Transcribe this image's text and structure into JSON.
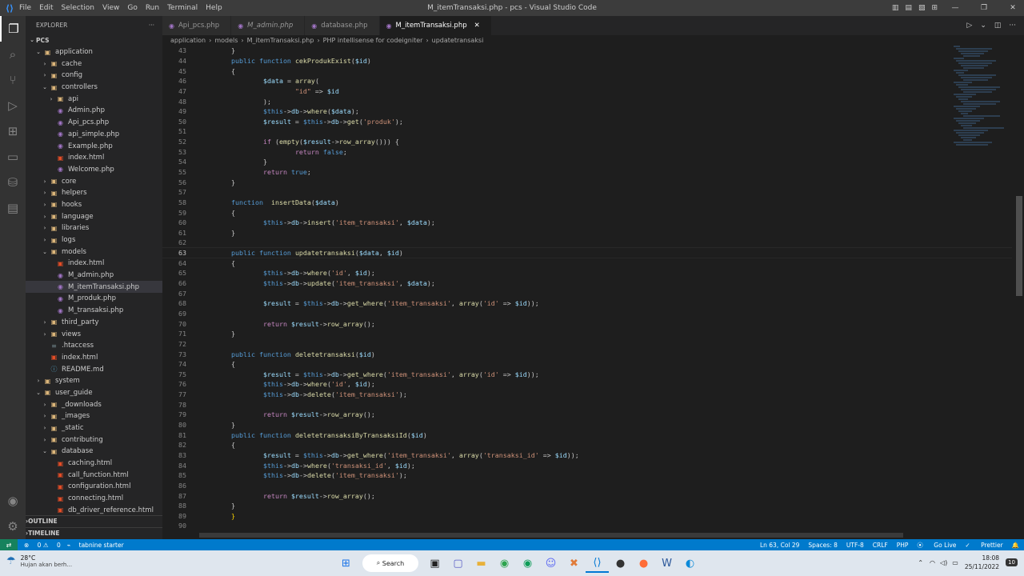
{
  "window": {
    "title": "M_itemTransaksi.php - pcs - Visual Studio Code",
    "menu": [
      "File",
      "Edit",
      "Selection",
      "View",
      "Go",
      "Run",
      "Terminal",
      "Help"
    ]
  },
  "sidebar": {
    "header": "EXPLORER",
    "root": "PCS",
    "tree": [
      {
        "label": "application",
        "depth": 1,
        "kind": "folder",
        "open": true
      },
      {
        "label": "cache",
        "depth": 2,
        "kind": "folder"
      },
      {
        "label": "config",
        "depth": 2,
        "kind": "folder"
      },
      {
        "label": "controllers",
        "depth": 2,
        "kind": "folder",
        "open": true
      },
      {
        "label": "api",
        "depth": 3,
        "kind": "folder"
      },
      {
        "label": "Admin.php",
        "depth": 3,
        "kind": "php"
      },
      {
        "label": "Api_pcs.php",
        "depth": 3,
        "kind": "php"
      },
      {
        "label": "api_simple.php",
        "depth": 3,
        "kind": "php"
      },
      {
        "label": "Example.php",
        "depth": 3,
        "kind": "php"
      },
      {
        "label": "index.html",
        "depth": 3,
        "kind": "html"
      },
      {
        "label": "Welcome.php",
        "depth": 3,
        "kind": "php"
      },
      {
        "label": "core",
        "depth": 2,
        "kind": "folder"
      },
      {
        "label": "helpers",
        "depth": 2,
        "kind": "folder"
      },
      {
        "label": "hooks",
        "depth": 2,
        "kind": "folder"
      },
      {
        "label": "language",
        "depth": 2,
        "kind": "folder"
      },
      {
        "label": "libraries",
        "depth": 2,
        "kind": "folder"
      },
      {
        "label": "logs",
        "depth": 2,
        "kind": "folder"
      },
      {
        "label": "models",
        "depth": 2,
        "kind": "folder",
        "open": true
      },
      {
        "label": "index.html",
        "depth": 3,
        "kind": "html"
      },
      {
        "label": "M_admin.php",
        "depth": 3,
        "kind": "php"
      },
      {
        "label": "M_itemTransaksi.php",
        "depth": 3,
        "kind": "php",
        "selected": true
      },
      {
        "label": "M_produk.php",
        "depth": 3,
        "kind": "php"
      },
      {
        "label": "M_transaksi.php",
        "depth": 3,
        "kind": "php"
      },
      {
        "label": "third_party",
        "depth": 2,
        "kind": "folder"
      },
      {
        "label": "views",
        "depth": 2,
        "kind": "folder"
      },
      {
        "label": ".htaccess",
        "depth": 2,
        "kind": "gen"
      },
      {
        "label": "index.html",
        "depth": 2,
        "kind": "html"
      },
      {
        "label": "README.md",
        "depth": 2,
        "kind": "md"
      },
      {
        "label": "system",
        "depth": 1,
        "kind": "folder"
      },
      {
        "label": "user_guide",
        "depth": 1,
        "kind": "folder",
        "open": true
      },
      {
        "label": "_downloads",
        "depth": 2,
        "kind": "folder"
      },
      {
        "label": "_images",
        "depth": 2,
        "kind": "folder"
      },
      {
        "label": "_static",
        "depth": 2,
        "kind": "folder"
      },
      {
        "label": "contributing",
        "depth": 2,
        "kind": "folder"
      },
      {
        "label": "database",
        "depth": 2,
        "kind": "folder",
        "open": true
      },
      {
        "label": "caching.html",
        "depth": 3,
        "kind": "html"
      },
      {
        "label": "call_function.html",
        "depth": 3,
        "kind": "html"
      },
      {
        "label": "configuration.html",
        "depth": 3,
        "kind": "html"
      },
      {
        "label": "connecting.html",
        "depth": 3,
        "kind": "html"
      },
      {
        "label": "db_driver_reference.html",
        "depth": 3,
        "kind": "html"
      }
    ],
    "outline": "OUTLINE",
    "timeline": "TIMELINE"
  },
  "tabs": [
    {
      "label": "Api_pcs.php"
    },
    {
      "label": "M_admin.php",
      "italic": true
    },
    {
      "label": "database.php"
    },
    {
      "label": "M_itemTransaksi.php",
      "active": true
    }
  ],
  "breadcrumb": [
    "application",
    "models",
    "M_itemTransaksi.php",
    "PHP intellisense for codeigniter",
    "updatetransaksi"
  ],
  "editor": {
    "first_line": 43,
    "current_line": 63,
    "lines": [
      [
        [
          "p",
          "}"
        ]
      ],
      [
        [
          "k",
          "public "
        ],
        [
          "k",
          "function "
        ],
        [
          "f",
          "cekProdukExist"
        ],
        [
          "p",
          "("
        ],
        [
          "v",
          "$id"
        ],
        [
          "p",
          ")"
        ]
      ],
      [
        [
          "p",
          "{"
        ]
      ],
      [
        [
          "p",
          "        "
        ],
        [
          "v",
          "$data"
        ],
        [
          "p",
          " = "
        ],
        [
          "f",
          "array"
        ],
        [
          "p",
          "("
        ]
      ],
      [
        [
          "p",
          "                "
        ],
        [
          "s",
          "\"id\""
        ],
        [
          "p",
          " => "
        ],
        [
          "v",
          "$id"
        ]
      ],
      [
        [
          "p",
          "        );"
        ]
      ],
      [
        [
          "p",
          "        "
        ],
        [
          "k",
          "$this"
        ],
        [
          "p",
          "->"
        ],
        [
          "v",
          "db"
        ],
        [
          "p",
          "->"
        ],
        [
          "f",
          "where"
        ],
        [
          "p",
          "("
        ],
        [
          "v",
          "$data"
        ],
        [
          "p",
          ");"
        ]
      ],
      [
        [
          "p",
          "        "
        ],
        [
          "v",
          "$result"
        ],
        [
          "p",
          " = "
        ],
        [
          "k",
          "$this"
        ],
        [
          "p",
          "->"
        ],
        [
          "v",
          "db"
        ],
        [
          "p",
          "->"
        ],
        [
          "f",
          "get"
        ],
        [
          "p",
          "("
        ],
        [
          "s",
          "'produk'"
        ],
        [
          "p",
          ");"
        ]
      ],
      [
        [
          "p",
          ""
        ]
      ],
      [
        [
          "p",
          "        "
        ],
        [
          "c",
          "if "
        ],
        [
          "p",
          "("
        ],
        [
          "f",
          "empty"
        ],
        [
          "p",
          "("
        ],
        [
          "v",
          "$result"
        ],
        [
          "p",
          "->"
        ],
        [
          "f",
          "row_array"
        ],
        [
          "p",
          "())) {"
        ]
      ],
      [
        [
          "p",
          "                "
        ],
        [
          "c",
          "return "
        ],
        [
          "k",
          "false"
        ],
        [
          "p",
          ";"
        ]
      ],
      [
        [
          "p",
          "        }"
        ]
      ],
      [
        [
          "p",
          "        "
        ],
        [
          "c",
          "return "
        ],
        [
          "k",
          "true"
        ],
        [
          "p",
          ";"
        ]
      ],
      [
        [
          "p",
          "}"
        ]
      ],
      [
        [
          "p",
          ""
        ]
      ],
      [
        [
          "k",
          "function "
        ],
        [
          "p",
          " "
        ],
        [
          "f",
          "insertData"
        ],
        [
          "p",
          "("
        ],
        [
          "v",
          "$data"
        ],
        [
          "p",
          ")"
        ]
      ],
      [
        [
          "p",
          "{"
        ]
      ],
      [
        [
          "p",
          "        "
        ],
        [
          "k",
          "$this"
        ],
        [
          "p",
          "->"
        ],
        [
          "v",
          "db"
        ],
        [
          "p",
          "->"
        ],
        [
          "f",
          "insert"
        ],
        [
          "p",
          "("
        ],
        [
          "s",
          "'item_transaksi'"
        ],
        [
          "p",
          ", "
        ],
        [
          "v",
          "$data"
        ],
        [
          "p",
          ");"
        ]
      ],
      [
        [
          "p",
          "}"
        ]
      ],
      [
        [
          "p",
          ""
        ]
      ],
      [
        [
          "k",
          "public "
        ],
        [
          "k",
          "function "
        ],
        [
          "f",
          "updatetransaksi"
        ],
        [
          "p",
          "("
        ],
        [
          "v",
          "$data"
        ],
        [
          "p",
          ", "
        ],
        [
          "v",
          "$id"
        ],
        [
          "p",
          ")"
        ]
      ],
      [
        [
          "p",
          "{"
        ]
      ],
      [
        [
          "p",
          "        "
        ],
        [
          "k",
          "$this"
        ],
        [
          "p",
          "->"
        ],
        [
          "v",
          "db"
        ],
        [
          "p",
          "->"
        ],
        [
          "f",
          "where"
        ],
        [
          "p",
          "("
        ],
        [
          "s",
          "'id'"
        ],
        [
          "p",
          ", "
        ],
        [
          "v",
          "$id"
        ],
        [
          "p",
          ");"
        ]
      ],
      [
        [
          "p",
          "        "
        ],
        [
          "k",
          "$this"
        ],
        [
          "p",
          "->"
        ],
        [
          "v",
          "db"
        ],
        [
          "p",
          "->"
        ],
        [
          "f",
          "update"
        ],
        [
          "p",
          "("
        ],
        [
          "s",
          "'item_transaksi'"
        ],
        [
          "p",
          ", "
        ],
        [
          "v",
          "$data"
        ],
        [
          "p",
          ");"
        ]
      ],
      [
        [
          "p",
          ""
        ]
      ],
      [
        [
          "p",
          "        "
        ],
        [
          "v",
          "$result"
        ],
        [
          "p",
          " = "
        ],
        [
          "k",
          "$this"
        ],
        [
          "p",
          "->"
        ],
        [
          "v",
          "db"
        ],
        [
          "p",
          "->"
        ],
        [
          "f",
          "get_where"
        ],
        [
          "p",
          "("
        ],
        [
          "s",
          "'item_transaksi'"
        ],
        [
          "p",
          ", "
        ],
        [
          "f",
          "array"
        ],
        [
          "p",
          "("
        ],
        [
          "s",
          "'id'"
        ],
        [
          "p",
          " => "
        ],
        [
          "v",
          "$id"
        ],
        [
          "p",
          "));"
        ]
      ],
      [
        [
          "p",
          ""
        ]
      ],
      [
        [
          "p",
          "        "
        ],
        [
          "c",
          "return "
        ],
        [
          "v",
          "$result"
        ],
        [
          "p",
          "->"
        ],
        [
          "f",
          "row_array"
        ],
        [
          "p",
          "();"
        ]
      ],
      [
        [
          "p",
          "}"
        ]
      ],
      [
        [
          "p",
          ""
        ]
      ],
      [
        [
          "k",
          "public "
        ],
        [
          "k",
          "function "
        ],
        [
          "f",
          "deletetransaksi"
        ],
        [
          "p",
          "("
        ],
        [
          "v",
          "$id"
        ],
        [
          "p",
          ")"
        ]
      ],
      [
        [
          "p",
          "{"
        ]
      ],
      [
        [
          "p",
          "        "
        ],
        [
          "v",
          "$result"
        ],
        [
          "p",
          " = "
        ],
        [
          "k",
          "$this"
        ],
        [
          "p",
          "->"
        ],
        [
          "v",
          "db"
        ],
        [
          "p",
          "->"
        ],
        [
          "f",
          "get_where"
        ],
        [
          "p",
          "("
        ],
        [
          "s",
          "'item_transaksi'"
        ],
        [
          "p",
          ", "
        ],
        [
          "f",
          "array"
        ],
        [
          "p",
          "("
        ],
        [
          "s",
          "'id'"
        ],
        [
          "p",
          " => "
        ],
        [
          "v",
          "$id"
        ],
        [
          "p",
          "));"
        ]
      ],
      [
        [
          "p",
          "        "
        ],
        [
          "k",
          "$this"
        ],
        [
          "p",
          "->"
        ],
        [
          "v",
          "db"
        ],
        [
          "p",
          "->"
        ],
        [
          "f",
          "where"
        ],
        [
          "p",
          "("
        ],
        [
          "s",
          "'id'"
        ],
        [
          "p",
          ", "
        ],
        [
          "v",
          "$id"
        ],
        [
          "p",
          ");"
        ]
      ],
      [
        [
          "p",
          "        "
        ],
        [
          "k",
          "$this"
        ],
        [
          "p",
          "->"
        ],
        [
          "v",
          "db"
        ],
        [
          "p",
          "->"
        ],
        [
          "f",
          "delete"
        ],
        [
          "p",
          "("
        ],
        [
          "s",
          "'item_transaksi'"
        ],
        [
          "p",
          ");"
        ]
      ],
      [
        [
          "p",
          ""
        ]
      ],
      [
        [
          "p",
          "        "
        ],
        [
          "c",
          "return "
        ],
        [
          "v",
          "$result"
        ],
        [
          "p",
          "->"
        ],
        [
          "f",
          "row_array"
        ],
        [
          "p",
          "();"
        ]
      ],
      [
        [
          "p",
          "}"
        ]
      ],
      [
        [
          "k",
          "public "
        ],
        [
          "k",
          "function "
        ],
        [
          "f",
          "deletetransaksiByTransaksiId"
        ],
        [
          "p",
          "("
        ],
        [
          "v",
          "$id"
        ],
        [
          "p",
          ")"
        ]
      ],
      [
        [
          "p",
          "{"
        ]
      ],
      [
        [
          "p",
          "        "
        ],
        [
          "v",
          "$result"
        ],
        [
          "p",
          " = "
        ],
        [
          "k",
          "$this"
        ],
        [
          "p",
          "->"
        ],
        [
          "v",
          "db"
        ],
        [
          "p",
          "->"
        ],
        [
          "f",
          "get_where"
        ],
        [
          "p",
          "("
        ],
        [
          "s",
          "'item_transaksi'"
        ],
        [
          "p",
          ", "
        ],
        [
          "f",
          "array"
        ],
        [
          "p",
          "("
        ],
        [
          "s",
          "'transaksi_id'"
        ],
        [
          "p",
          " => "
        ],
        [
          "v",
          "$id"
        ],
        [
          "p",
          "));"
        ]
      ],
      [
        [
          "p",
          "        "
        ],
        [
          "k",
          "$this"
        ],
        [
          "p",
          "->"
        ],
        [
          "v",
          "db"
        ],
        [
          "p",
          "->"
        ],
        [
          "f",
          "where"
        ],
        [
          "p",
          "("
        ],
        [
          "s",
          "'transaksi_id'"
        ],
        [
          "p",
          ", "
        ],
        [
          "v",
          "$id"
        ],
        [
          "p",
          ");"
        ]
      ],
      [
        [
          "p",
          "        "
        ],
        [
          "k",
          "$this"
        ],
        [
          "p",
          "->"
        ],
        [
          "v",
          "db"
        ],
        [
          "p",
          "->"
        ],
        [
          "f",
          "delete"
        ],
        [
          "p",
          "("
        ],
        [
          "s",
          "'item_transaksi'"
        ],
        [
          "p",
          ");"
        ]
      ],
      [
        [
          "p",
          ""
        ]
      ],
      [
        [
          "p",
          "        "
        ],
        [
          "c",
          "return "
        ],
        [
          "v",
          "$result"
        ],
        [
          "p",
          "->"
        ],
        [
          "f",
          "row_array"
        ],
        [
          "p",
          "();"
        ]
      ],
      [
        [
          "p",
          "}"
        ]
      ],
      [
        [
          "br",
          "}"
        ]
      ],
      [
        [
          "p",
          ""
        ]
      ]
    ]
  },
  "statusbar": {
    "errors": "0",
    "warnings": "0",
    "tabnine": "tabnine starter",
    "position": "Ln 63, Col 29",
    "spaces": "Spaces: 8",
    "encoding": "UTF-8",
    "eol": "CRLF",
    "language": "PHP",
    "golive": "Go Live",
    "prettier": "Prettier"
  },
  "taskbar": {
    "temp": "28°C",
    "weather": "Hujan akan berh...",
    "search": "Search",
    "time": "18:08",
    "date": "25/11/2022",
    "badge": "10"
  }
}
